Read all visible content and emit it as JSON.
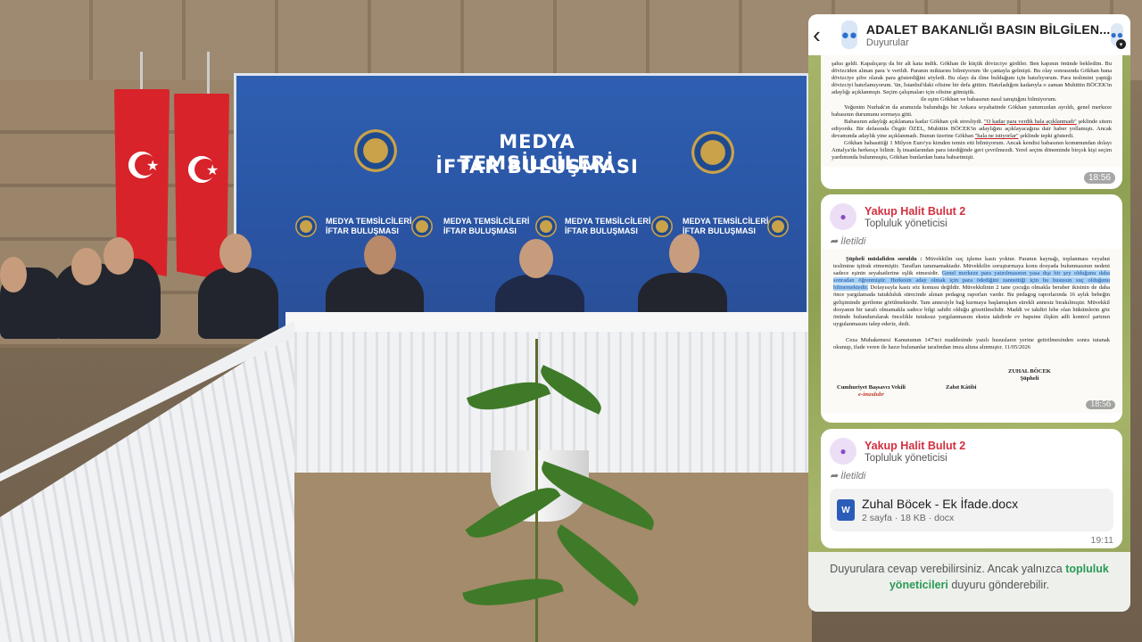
{
  "banner": {
    "line1": "MEDYA TEMSİLCİLERİ",
    "line2": "İFTAR BULUŞMASI",
    "mini_line1": "MEDYA TEMSİLCİLERİ",
    "mini_line2": "İFTAR BULUŞMASI"
  },
  "chat": {
    "title": "ADALET BAKANLIĞI BASIN BİLGİLEN...",
    "subtitle": "Duyurular",
    "header_icon": "community-icon"
  },
  "messages": [
    {
      "type": "image",
      "time": "18:56",
      "doc_paragraph_1": "şahsı geldi. Kapalıçarşı da bir alt kata indik. Gökhan ile küçük dövizciye girdiler. Ben kapının önünde bekledim. Bu dövizciden alınan para 'e verildi. Paranın miktarını bilmiyorum 'de çantayla gelmişti. Bu olay sonrasında Gökhan bana dövizciye şifre olarak para gösterdiğini söyledi. Bu olayı da iline bulduğum için hatırlıyorum. Para teslimini yaptığı dövizciyi hatırlamıyorum. 'ün, İstanbul'daki ofisine bir defa gittim. Hatırladığım kadarıyla o zaman Muhittin BÖCEK'in adaylığı açıklanmıştı. Seçim çalışmaları için ofisine gitmiştik.",
      "doc_paragraph_2": "ile eşim Gökhan ve babasının nasıl tanıştığını bilmiyorum.",
      "doc_paragraph_3": "Yeğenim Nurhak'ın da aramızda bulunduğu bir Ankara seyahatinde Gökhan yanımızdan ayrıldı, genel merkeze babasının durumunu sormaya gitti.",
      "doc_paragraph_4_pre": "Babasının adaylığı açıklanana kadar Gökhan çok stresliydi.",
      "doc_paragraph_4_ul": "\"O kadar para verdik hala açıklanmadı\"",
      "doc_paragraph_4_post": "şeklinde sitem ediyordu. Bir defasında Özgür ÖZEL, Muhittin BÖCEK'in adaylığını açıklayacağına dair haber yollamıştı. Ancak devamında adaylık yine açıklanmadı. Bunun üzerine Gökhan",
      "doc_paragraph_4_ul2": "\"hala ne istiyorlar\"",
      "doc_paragraph_4_end": "şeklinde tepki gösterdi.",
      "doc_paragraph_5": "Gökhan babasıttiği 1 Milyon Euro'yu kimden temin etti bilmiyorum. Ancak kendisi babasının konumundan dolayı Antalya'da herkesçe bilinir. İş insanlarından para istediğinde geri çevrilmezdi. Yerel seçim döneminde birçok kişi seçim yardımında bulunmuştu, Gökhan bunlardan bana bahsetmişti."
    },
    {
      "type": "image",
      "sender": "Yakup Halit Bulut 2",
      "role": "Topluluk yöneticisi",
      "forwarded": "İletildi",
      "time": "18:56",
      "doc_heading": "Şüpheli müdafiden soruldu :",
      "doc_text_pre": "Müvekkilin suç işleme kastı yoktur. Paranın kaynağı, toplanması veyahut teslimine iştirak etmemiştir. Tarafları tanımamaktadır. Müvekkilin soruşturmaya konu dosyada bulunmasının nedeni sadece eşinin seyahatlerine eşlik etmesidir.",
      "doc_text_hl": "Genel merkeze para yatırılmasının yasa dışı bir şey olduğunu daha sonradan öğrenmiştir. Herkesin aday olmak için para ödediğini zannettiği için bu hususun suç olduğunu bilmemektedir.",
      "doc_text_post": "Dolayısıyla kastı söz konusu değildir. Müvekkilinin 2 tane çocuğu olmakla beraber ikisinin de daha önce yargılamada tutukluluk sürecinde alınan pedagog raporları vardır. Bu pedagog raporlarında 16 aylık bebeğin gelişiminde gerileme görülmektedir. Tam annesiyle bağ kurmaya başlamışken sürekli annesiz bırakılmıştır. Müvekkil dosyanın bir tarafı olmamakla sadece bilgi sahibi olduğu gözetilmelidir. Maddi ve takdiri lehe olan hükümlerin göz önünde bulundurularak öncelikle tutuksuz yargılanmasını ekstra takdirde ev hapsine ilişkin adli kontrol şartının uygulanmasını talep ederiz, dedi.",
      "doc_closing": "Ceza Muhakemesi Kanununun 147'nci maddesinde yazılı hususların yerine getirilmesinden sonra tutanak okunup, ifade veren ile hazır bulunanlar tarafından imza altına alınmıştır. 11/05/2026",
      "sig_suspect_name": "ZUHAL BÖCEK",
      "sig_suspect_role": "Şüpheli",
      "sig_prosecutor": "Cumhuriyet Başsavcı Vekili",
      "sig_esign": "e-imzalıdır",
      "sig_clerk": "Zabıt Kâtibi"
    },
    {
      "type": "file",
      "sender": "Yakup Halit Bulut 2",
      "role": "Topluluk yöneticisi",
      "forwarded": "İletildi",
      "file_name": "Zuhal Böcek - Ek İfade.docx",
      "file_pages": "2 sayfa",
      "file_size": "18 KB",
      "file_ext": "docx",
      "file_meta": "2 sayfa · 18 KB · docx",
      "time": "19:11"
    }
  ],
  "footer": {
    "text_pre": "Duyurulara cevap verebilirsiniz. Ancak yalnızca",
    "link": "topluluk yöneticileri",
    "text_post": "duyuru gönderebilir."
  }
}
